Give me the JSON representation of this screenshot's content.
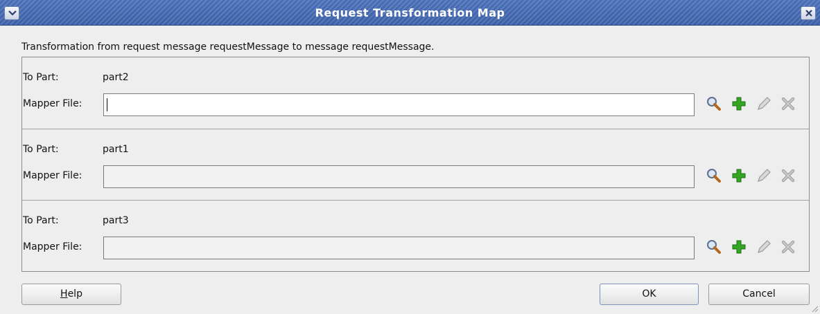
{
  "window": {
    "title": "Request Transformation Map"
  },
  "description": "Transformation from request message requestMessage to message requestMessage.",
  "parts": [
    {
      "to_part_label": "To Part:",
      "to_part_value": "part2",
      "mapper_label": "Mapper File:",
      "mapper_value": ""
    },
    {
      "to_part_label": "To Part:",
      "to_part_value": "part1",
      "mapper_label": "Mapper File:",
      "mapper_value": ""
    },
    {
      "to_part_label": "To Part:",
      "to_part_value": "part3",
      "mapper_label": "Mapper File:",
      "mapper_value": ""
    }
  ],
  "icons": {
    "search": "magnifier-icon",
    "add": "plus-icon",
    "edit": "pencil-icon",
    "delete": "x-delete-icon"
  },
  "buttons": {
    "help_rest": "elp",
    "help_mnemonic": "H",
    "ok": "OK",
    "cancel": "Cancel"
  },
  "colors": {
    "titlebar": "#3c5fa6",
    "add_green": "#2e9b1e",
    "background": "#eeeeee"
  }
}
